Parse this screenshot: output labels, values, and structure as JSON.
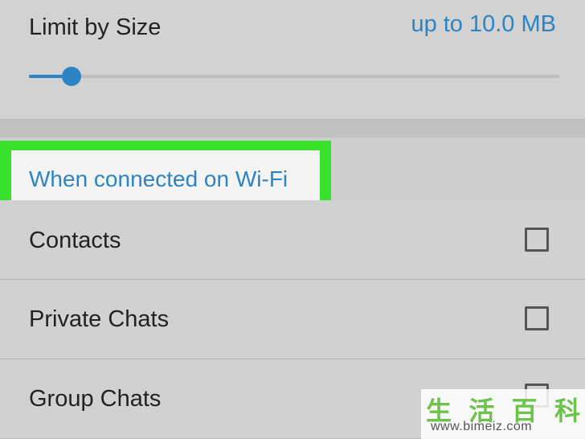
{
  "limit": {
    "label": "Limit by Size",
    "value_text": "up to 10.0 MB",
    "slider_level": 0.08
  },
  "section": {
    "header": "When connected on Wi-Fi"
  },
  "rows": [
    {
      "label": "Contacts",
      "checked": false
    },
    {
      "label": "Private Chats",
      "checked": false
    },
    {
      "label": "Group Chats",
      "checked": false
    }
  ],
  "colors": {
    "accent": "#2d84c4",
    "highlight": "#39e22a"
  },
  "watermark": {
    "chars": [
      "生",
      "活",
      "百",
      "科"
    ],
    "url": "www.bimeiz.com"
  }
}
